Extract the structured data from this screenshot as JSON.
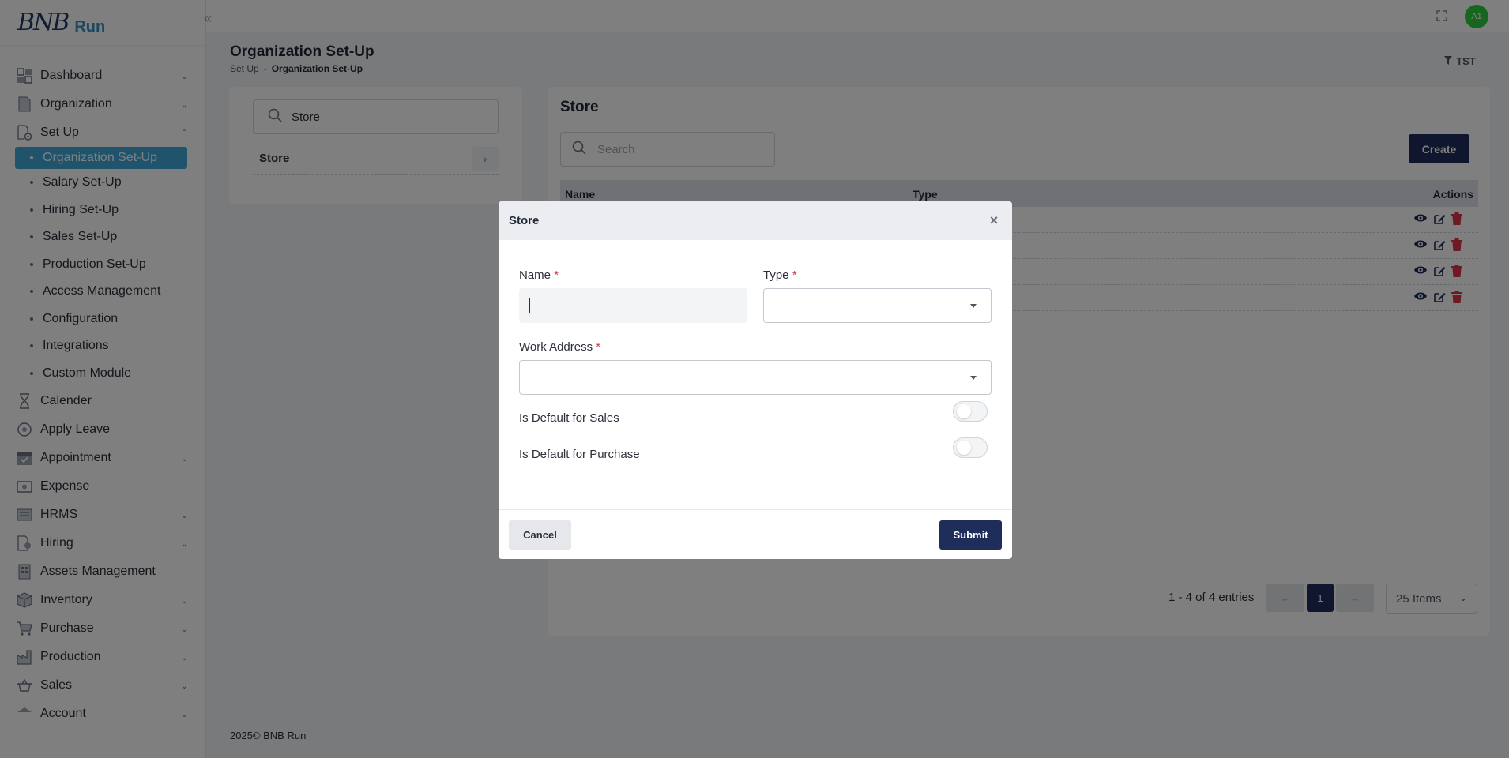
{
  "brand": {
    "logo_text": "BNB",
    "logo_suffix": "Run"
  },
  "topbar": {
    "avatar_initials": "A1"
  },
  "sidebar": {
    "items": [
      {
        "label": "Dashboard",
        "icon": "dashboard-icon",
        "chevron": "down"
      },
      {
        "label": "Organization",
        "icon": "document-icon",
        "chevron": "down"
      },
      {
        "label": "Set Up",
        "icon": "setup-icon",
        "chevron": "up"
      },
      {
        "label": "Calender",
        "icon": "hourglass-icon"
      },
      {
        "label": "Apply Leave",
        "icon": "leave-icon"
      },
      {
        "label": "Appointment",
        "icon": "calendar-check-icon",
        "chevron": "down"
      },
      {
        "label": "Expense",
        "icon": "expense-icon"
      },
      {
        "label": "HRMS",
        "icon": "hrms-icon",
        "chevron": "down"
      },
      {
        "label": "Hiring",
        "icon": "hiring-icon",
        "chevron": "down"
      },
      {
        "label": "Assets Management",
        "icon": "assets-icon"
      },
      {
        "label": "Inventory",
        "icon": "inventory-icon",
        "chevron": "down"
      },
      {
        "label": "Purchase",
        "icon": "cart-icon",
        "chevron": "down"
      },
      {
        "label": "Production",
        "icon": "factory-icon",
        "chevron": "down"
      },
      {
        "label": "Sales",
        "icon": "sales-icon",
        "chevron": "down"
      },
      {
        "label": "Account",
        "icon": "account-icon",
        "chevron": "down"
      }
    ],
    "setup_sub": [
      {
        "label": "Organization Set-Up",
        "active": true
      },
      {
        "label": "Salary Set-Up"
      },
      {
        "label": "Hiring Set-Up"
      },
      {
        "label": "Sales Set-Up"
      },
      {
        "label": "Production Set-Up"
      },
      {
        "label": "Access Management"
      },
      {
        "label": "Configuration"
      },
      {
        "label": "Integrations"
      },
      {
        "label": "Custom Module"
      }
    ]
  },
  "header": {
    "title": "Organization Set-Up",
    "breadcrumb": {
      "parent": "Set Up",
      "separator": "-",
      "current": "Organization Set-Up"
    },
    "filter_label": "TST"
  },
  "left_panel": {
    "search_value": "Store",
    "items": [
      {
        "label": "Store"
      }
    ]
  },
  "main": {
    "title": "Store",
    "search_placeholder": "Search",
    "create_label": "Create",
    "columns": {
      "name": "Name",
      "type": "Type",
      "actions": "Actions"
    },
    "row_count": 4,
    "pagination": {
      "info": "1 - 4 of 4 entries",
      "prev": "←",
      "page": "1",
      "next": "→",
      "page_size": "25 Items"
    }
  },
  "modal": {
    "title": "Store",
    "name_label": "Name",
    "type_label": "Type",
    "address_label": "Work Address",
    "required_mark": "*",
    "default_sales_label": "Is Default for Sales",
    "default_purchase_label": "Is Default for Purchase",
    "default_sales_on": false,
    "default_purchase_on": false,
    "cancel_label": "Cancel",
    "submit_label": "Submit"
  },
  "footer": {
    "text": "2025© BNB Run"
  },
  "colors": {
    "primary": "#1e2d5a",
    "active_nav": "#3ea9d8",
    "avatar": "#2ecc40",
    "delete": "#dc3545",
    "action_icon": "#1e2d5a"
  }
}
